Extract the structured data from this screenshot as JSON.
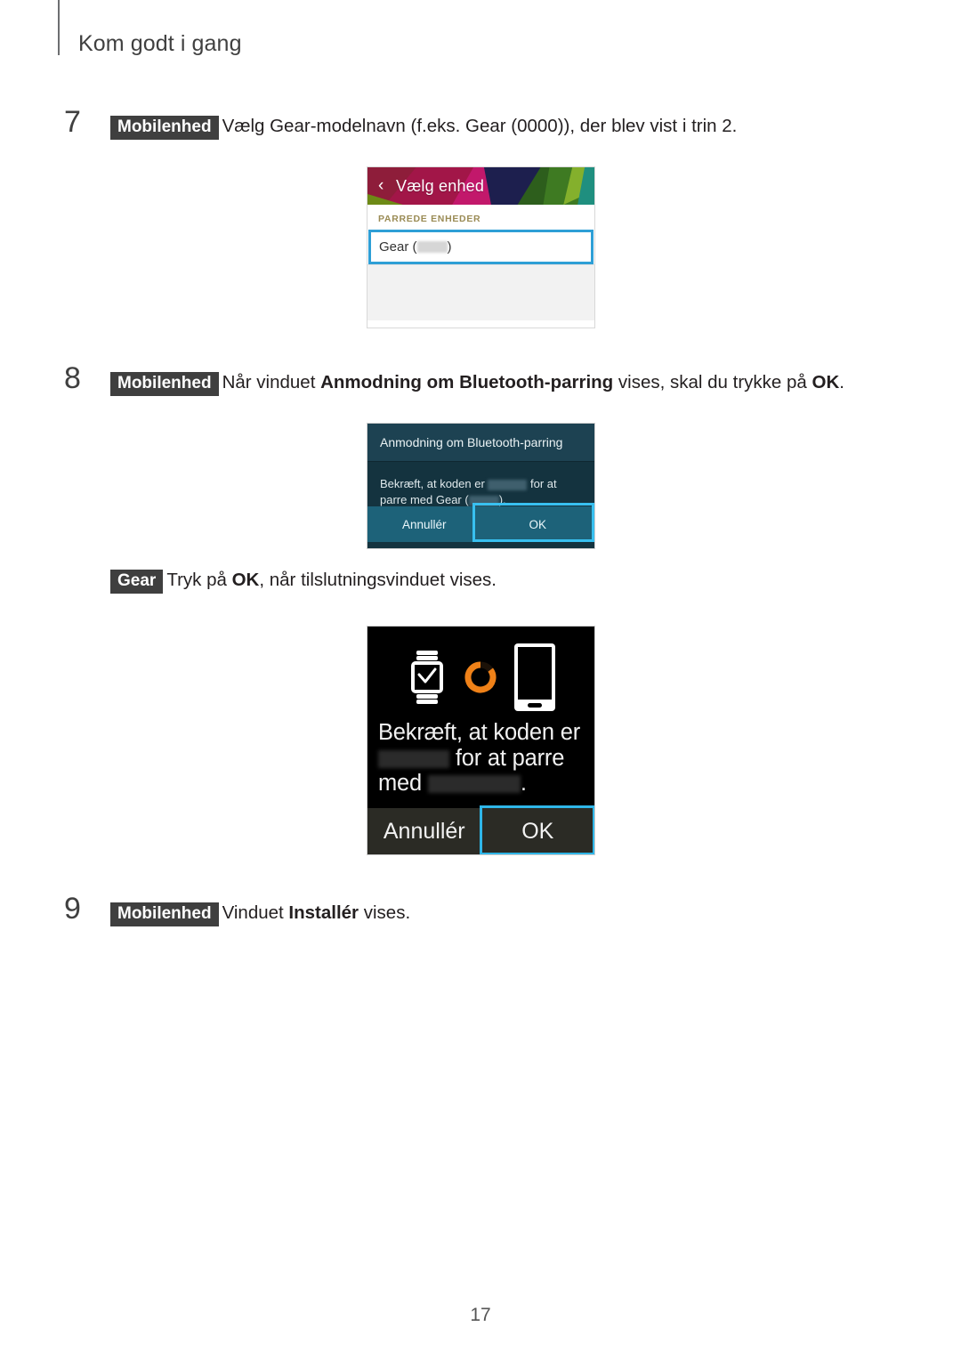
{
  "header": {
    "chapter_title": "Kom godt i gang"
  },
  "footer": {
    "page_number": "17"
  },
  "steps": [
    {
      "number": "7",
      "tag": "Mobilenhed",
      "text_before": "Vælg Gear-modelnavn (f.eks. Gear (0000)), der blev vist i trin 2."
    },
    {
      "number": "8",
      "tag": "Mobilenhed",
      "text_a": "Når vinduet ",
      "bold_a": "Anmodning om Bluetooth-parring",
      "text_b": " vises, skal du trykke på ",
      "bold_b": "OK",
      "text_c": "."
    },
    {
      "number": "9",
      "tag": "Mobilenhed",
      "text_a": "Vinduet ",
      "bold_a": "Installér",
      "text_b": " vises."
    }
  ],
  "substep_gear": {
    "tag": "Gear",
    "text_a": "Tryk på ",
    "bold_a": "OK",
    "text_b": ", når tilslutningsvinduet vises."
  },
  "device_picker": {
    "back_icon": "chevron-left-icon",
    "title": "Vælg enhed",
    "section_label": "PARREDE ENHEDER",
    "item_prefix": "Gear (",
    "item_suffix": ")",
    "highlight_color": "#2e9fd6"
  },
  "bluetooth_dialog": {
    "title": "Anmodning om Bluetooth-parring",
    "body_line1_a": "Bekræft, at koden er ",
    "body_line1_b": " for at",
    "body_line2_a": "parre med Gear (",
    "body_line2_b": ").",
    "cancel_label": "Annullér",
    "ok_label": "OK",
    "background_color": "#14333f",
    "titlebar_color": "#1d4252",
    "action_bar_color": "#1d6279",
    "highlight_color": "#38c0f0"
  },
  "gear_watch_screen": {
    "watch_icon": "smartwatch-check-icon",
    "spinner_icon": "orange-loading-ring-icon",
    "phone_icon": "smartphone-icon",
    "line1": "Bekræft, at koden er",
    "line2_b": " for at parre",
    "line3_a": "med",
    "line3_c": ".",
    "cancel_label": "Annullér",
    "ok_label": "OK",
    "background_color": "#000000",
    "action_bar_color": "#2b2b25",
    "spinner_color": "#ef8118",
    "highlight_color": "#2fb6e8"
  }
}
